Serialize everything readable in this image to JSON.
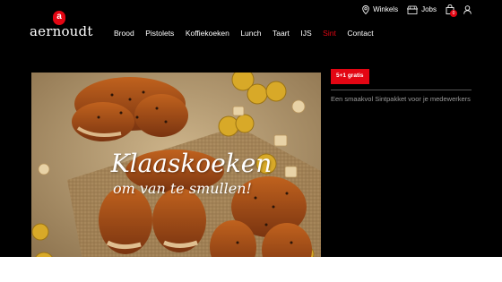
{
  "brand": {
    "logo_letter": "a",
    "logo_text": "aernoudt",
    "accent": "#e30613"
  },
  "utility": {
    "stores_label": "Winkels",
    "jobs_label": "Jobs",
    "cart_count": "0"
  },
  "nav": {
    "items": [
      "Brood",
      "Pistolets",
      "Koffiekoeken",
      "Lunch",
      "Taart",
      "IJS",
      "Sint",
      "Contact"
    ],
    "active": "Sint"
  },
  "hero": {
    "title_line1": "Klaaskoeken",
    "title_line2": "om van te smullen!"
  },
  "promo": {
    "badge": "5+1 gratis",
    "text": "Een smaakvol Sintpakket voor je medewerkers"
  }
}
